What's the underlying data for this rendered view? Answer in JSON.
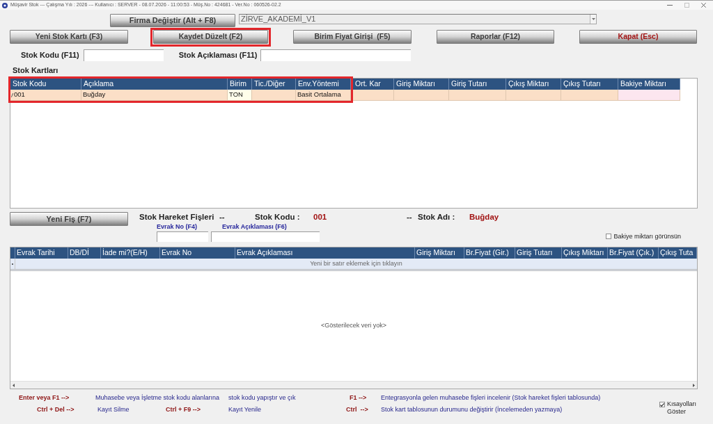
{
  "window": {
    "title": "Müşavir Stok --- Çalışma Yılı : 2026 --- Kullanıcı : SERVER - 08.07.2026 - 11:00:53 - Müş.No : 424681 - Ver.No : 060526-02.2"
  },
  "company": {
    "button": "Firma Değiştir (Alt + F8)",
    "selector": {
      "value": "ZİRVE_AKADEMİ_V1"
    }
  },
  "actions": [
    {
      "label": "Yeni Stok Kartı (F3)",
      "kind": "normal",
      "highlighted": false
    },
    {
      "label": "Kaydet Düzelt (F2)",
      "kind": "normal",
      "highlighted": true
    },
    {
      "label": "Birim Fiyat Girişi  (F5)",
      "kind": "normal",
      "highlighted": false
    },
    {
      "label": "Raporlar (F12)",
      "kind": "normal",
      "highlighted": false
    },
    {
      "label": "Kapat (Esc)",
      "kind": "danger",
      "highlighted": false
    }
  ],
  "search": [
    {
      "label": "Stok Kodu (F11)"
    },
    {
      "label": "Stok Açıklaması (F11)"
    }
  ],
  "stock_cards": {
    "title": "Stok Kartları",
    "columns": [
      {
        "label": "Stok Kodu",
        "kind": "framed"
      },
      {
        "label": "Açıklama",
        "kind": "framed"
      },
      {
        "label": "Birim",
        "kind": "framed"
      },
      {
        "label": "Tic./Diğer",
        "kind": "framed"
      },
      {
        "label": "Env.Yöntemi",
        "kind": "framed"
      },
      {
        "label": "Ort. Kar",
        "kind": "plain"
      },
      {
        "label": "Giriş Miktarı",
        "kind": "plain"
      },
      {
        "label": "Giriş Tutarı",
        "kind": "plain"
      },
      {
        "label": "Çıkış Miktarı",
        "kind": "plain"
      },
      {
        "label": "Çıkış Tutarı",
        "kind": "plain"
      },
      {
        "label": "Bakiye Miktarı",
        "kind": "balance"
      }
    ],
    "rows": [
      {
        "selected": true,
        "cells": [
          {
            "text": "001",
            "focused": false
          },
          {
            "text": "Buğday",
            "focused": false
          },
          {
            "text": "TON",
            "focused": true
          },
          {
            "focused": false
          },
          {
            "text": "Basit Ortalama",
            "focused": false
          },
          {
            "focused": false
          },
          {
            "focused": false
          },
          {
            "focused": false
          },
          {
            "focused": false
          },
          {
            "focused": false
          },
          {
            "focused": false
          }
        ]
      }
    ]
  },
  "movements": {
    "new_button": "Yeni Fiş (F7)",
    "heading": [
      {
        "kind": "title",
        "text": "Stok Hareket Fişleri"
      },
      {
        "kind": "separator",
        "text": "--"
      },
      {
        "kind": "label",
        "text": "Stok Kodu :"
      },
      {
        "kind": "value",
        "text": "001"
      },
      {
        "kind": "separator",
        "text": "--"
      },
      {
        "kind": "label",
        "text": "Stok Adı :"
      },
      {
        "kind": "value",
        "text": "Buğday"
      }
    ],
    "filters": [
      {
        "label": "Evrak No (F4)"
      },
      {
        "label": "Evrak Açıklaması (F6)"
      }
    ],
    "balance_toggle": {
      "label": "Bakiye miktarı görünsün",
      "checked": false
    },
    "columns": [
      {
        "label": "Evrak Tarihi"
      },
      {
        "label": "DB/Dİ"
      },
      {
        "label": "İade mi?(E/H)"
      },
      {
        "label": "Evrak No"
      },
      {
        "label": "Evrak Açıklaması"
      },
      {
        "label": "Giriş Miktarı"
      },
      {
        "label": "Br.Fiyat (Gir.)"
      },
      {
        "label": "Giriş Tutarı"
      },
      {
        "label": "Çıkış Miktarı"
      },
      {
        "label": "Br.Fiyat (Çık.)"
      },
      {
        "label": "Çıkış Tuta"
      }
    ],
    "new_row_hint": "Yeni bir satır eklemek için tıklayın",
    "empty_text": "<Gösterilecek veri yok>"
  },
  "shortcuts": {
    "lines": [
      [
        {
          "kind": "key",
          "text": "Enter veya F1 -->"
        },
        {
          "kind": "description",
          "text": "Muhasebe veya İşletme stok kodu alanlarına"
        },
        {
          "kind": "description",
          "text": "stok kodu yapıştır ve çık"
        },
        {
          "kind": "key",
          "text": "F1 -->"
        },
        {
          "kind": "description",
          "text": "Entegrasyonla gelen muhasebe fişleri incelenir (Stok hareket fişleri tablosunda)"
        }
      ],
      [
        {
          "kind": "key",
          "text": "Ctrl + Del -->"
        },
        {
          "kind": "description",
          "text": "Kayıt Silme"
        },
        {
          "kind": "key",
          "text": "Ctrl + F9 -->"
        },
        {
          "kind": "description",
          "text": "Kayıt Yenile"
        },
        {
          "kind": "key",
          "text": "Ctrl  -->"
        },
        {
          "kind": "description",
          "text": "Stok kart tablosunun durumunu değiştirir (İncelemeden yazmaya)"
        }
      ]
    ],
    "toggle": {
      "label": "Kısayolları Göster",
      "checked": true
    }
  }
}
